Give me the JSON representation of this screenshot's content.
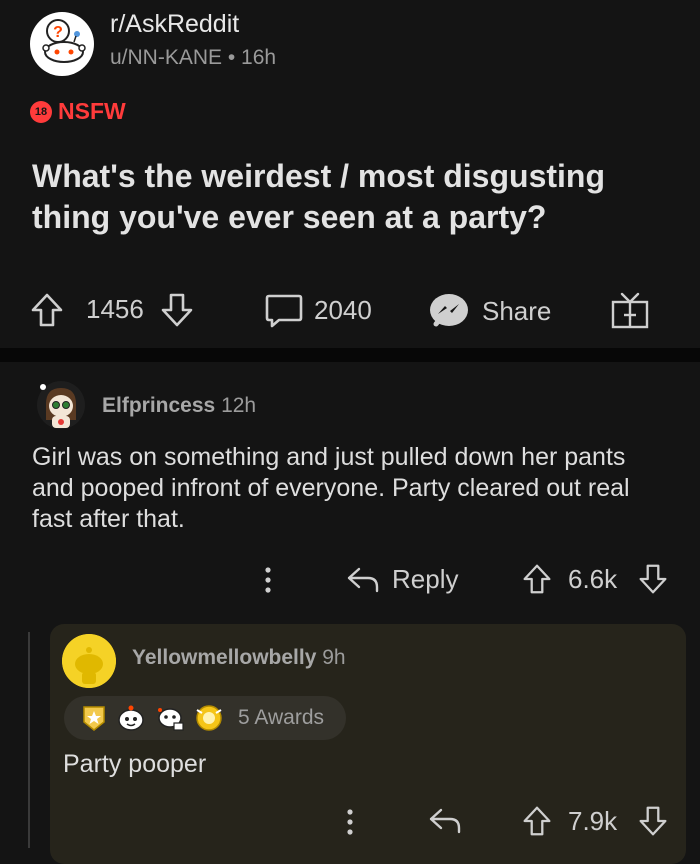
{
  "post": {
    "subreddit": "r/AskReddit",
    "author_meta": "u/NN-KANE • 16h",
    "nsfw_badge": "18",
    "nsfw_label": "NSFW",
    "title": "What's the weirdest / most disgusting thing you've ever seen at a party?",
    "votes": "1456",
    "comments": "2040",
    "share_label": "Share"
  },
  "comment": {
    "username": "Elfprincess",
    "age": "12h",
    "body": "Girl was on something and just pulled down her pants and pooped infront of everyone. Party cleared out real fast after that.",
    "reply_label": "Reply",
    "score": "6.6k"
  },
  "reply": {
    "username": "Yellowmellowbelly",
    "age": "9h",
    "awards_label": "5 Awards",
    "body": "Party pooper",
    "score": "7.9k"
  },
  "colors": {
    "background": "#141414",
    "nsfw": "#ff3b3b",
    "reply_card": "#26241b",
    "reply_avatar": "#f5d226"
  }
}
